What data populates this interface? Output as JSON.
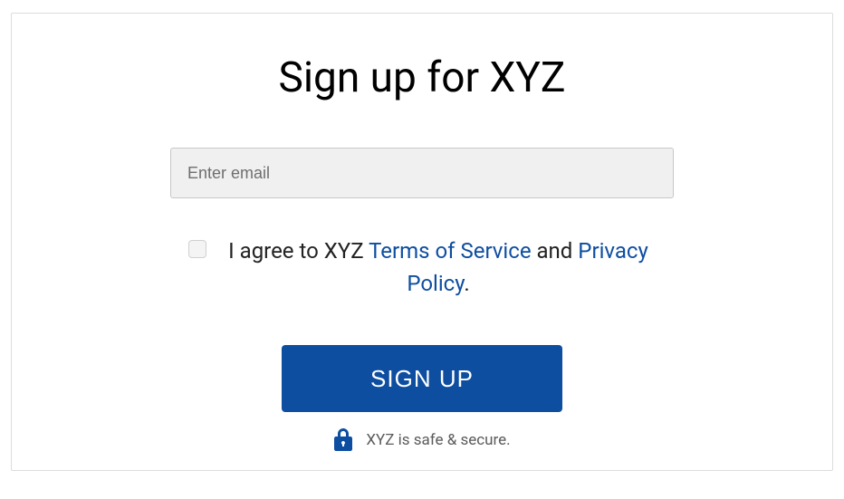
{
  "title": "Sign up for XYZ",
  "email": {
    "placeholder": "Enter email",
    "value": ""
  },
  "agreement": {
    "prefix": "I agree to XYZ ",
    "tos_label": "Terms of Service",
    "middle": " and ",
    "privacy_label": "Privacy Policy",
    "suffix": "."
  },
  "signup_button": "SIGN UP",
  "secure_text": "XYZ is safe & secure.",
  "colors": {
    "primary": "#0e4ea1",
    "link": "#0e4ea1"
  }
}
